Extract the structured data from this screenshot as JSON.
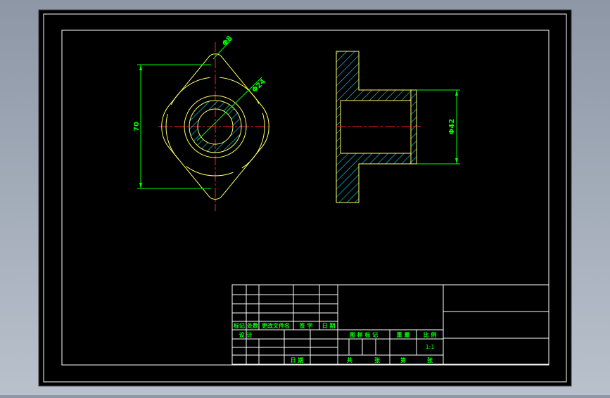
{
  "drawing": {
    "dims": {
      "diameter_top": "Φ8",
      "diameter_mid": "Φ24",
      "height": "70",
      "bore": "Φ42"
    },
    "title_block": {
      "change_labels": [
        "标记",
        "处数",
        "更改文件名",
        "签 字",
        "日 期"
      ],
      "design_label": "设 计",
      "date_label": "日 期",
      "drawing_mark_label": "图 样 标 记",
      "weight_label": "重 量",
      "scale_label": "比 例",
      "scale_value": "1:1",
      "sheets_total_label": "共",
      "sheet_unit_label": "张",
      "sheet_no_label": "第",
      "sheet_unit_label2": "张"
    }
  },
  "colors": {
    "background": "#000000",
    "frame": "#ffffff",
    "outline_yellow": "#ffff66",
    "center_red": "#ff2020",
    "dimension_green": "#00ff00",
    "hatch_cyan": "#00ffff"
  }
}
